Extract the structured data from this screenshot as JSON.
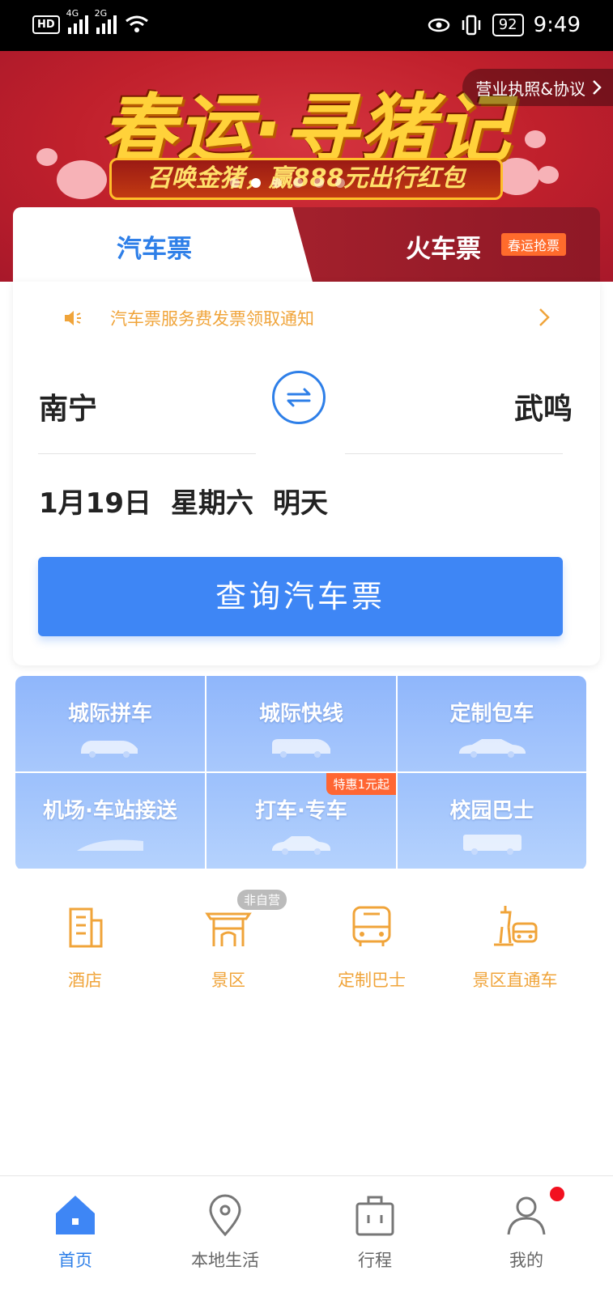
{
  "status_bar": {
    "hd": "HD",
    "net1": "4G",
    "net2": "2G",
    "battery": "92",
    "time": "9:49"
  },
  "banner": {
    "title": "春运·寻猪记",
    "subtitle": "召唤金猪，赢888元出行红包",
    "license_link": "营业执照&协议"
  },
  "tabs": {
    "bus": "汽车票",
    "train": "火车票",
    "train_badge": "春运抢票"
  },
  "notice": {
    "text": "汽车票服务费发票领取通知"
  },
  "route": {
    "from": "南宁",
    "to": "武鸣"
  },
  "date": {
    "date": "1月19日",
    "weekday": "星期六",
    "relative": "明天"
  },
  "query_button": "查询汽车票",
  "services": [
    {
      "label": "城际拼车"
    },
    {
      "label": "城际快线"
    },
    {
      "label": "定制包车"
    },
    {
      "label": "机场·车站接送"
    },
    {
      "label": "打车·专车",
      "promo": "特惠1元起"
    },
    {
      "label": "校园巴士"
    }
  ],
  "quick_icons": [
    {
      "label": "酒店",
      "icon": "hotel-icon"
    },
    {
      "label": "景区",
      "icon": "scenic-gate-icon",
      "tag": "非自营"
    },
    {
      "label": "定制巴士",
      "icon": "bus-icon"
    },
    {
      "label": "景区直通车",
      "icon": "tower-bus-icon"
    }
  ],
  "bottom_nav": [
    {
      "label": "首页",
      "icon": "home-icon"
    },
    {
      "label": "本地生活",
      "icon": "location-pin-icon"
    },
    {
      "label": "行程",
      "icon": "suitcase-icon"
    },
    {
      "label": "我的",
      "icon": "user-icon"
    }
  ],
  "colors": {
    "accent_blue": "#3e86f5",
    "orange": "#f0a43a",
    "banner_red": "#c0202c"
  }
}
